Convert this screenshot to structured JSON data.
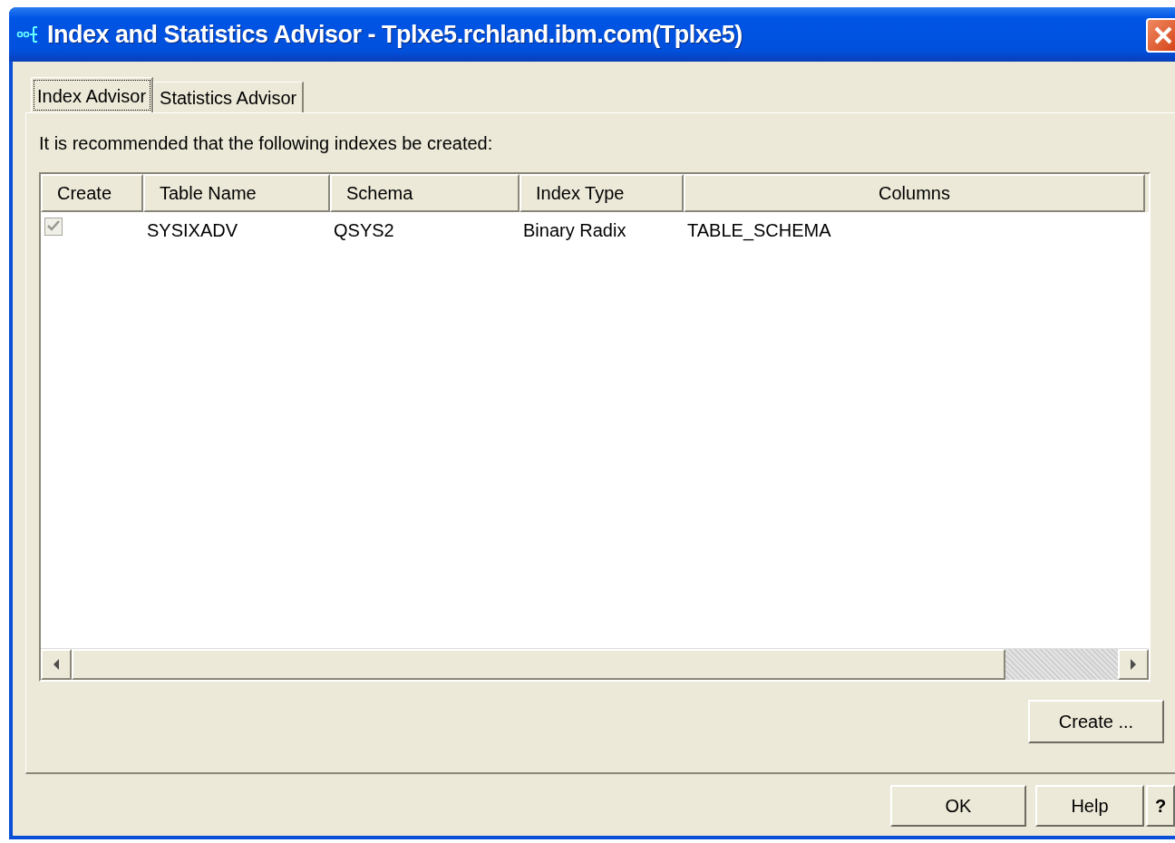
{
  "window": {
    "title": "Index and Statistics Advisor - Tplxe5.rchland.ibm.com(Tplxe5)"
  },
  "tabs": [
    {
      "label": "Index Advisor",
      "selected": true
    },
    {
      "label": "Statistics Advisor",
      "selected": false
    }
  ],
  "description": "It is recommended that the following indexes be created:",
  "table": {
    "columns": [
      "Create",
      "Table Name",
      "Schema",
      "Index Type",
      "Columns"
    ],
    "rows": [
      {
        "checked": true,
        "disabled": true,
        "cells": [
          "",
          "SYSIXADV",
          "QSYS2",
          "Binary Radix",
          "TABLE_SCHEMA"
        ]
      }
    ]
  },
  "create_button": "Create ...",
  "buttons": [
    "OK",
    "Help",
    "?"
  ]
}
